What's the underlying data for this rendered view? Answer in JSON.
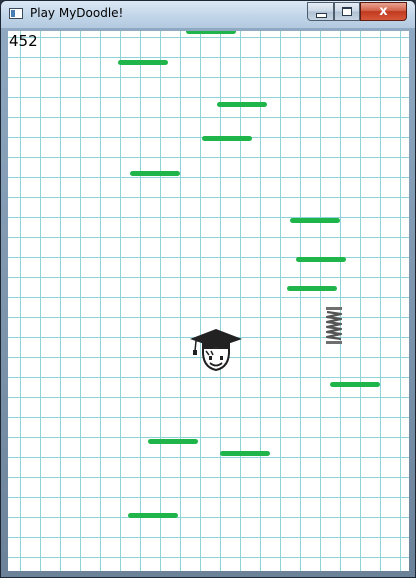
{
  "window": {
    "title": "Play MyDoodle!",
    "minimize_label": "",
    "maximize_label": "",
    "close_label": "x"
  },
  "game": {
    "score": "452",
    "player": "doodler-graduation-cap",
    "platform_color": "#1fb54a",
    "grid_color": "#8fd3d8",
    "platform_count": 12,
    "spring_count": 1
  }
}
